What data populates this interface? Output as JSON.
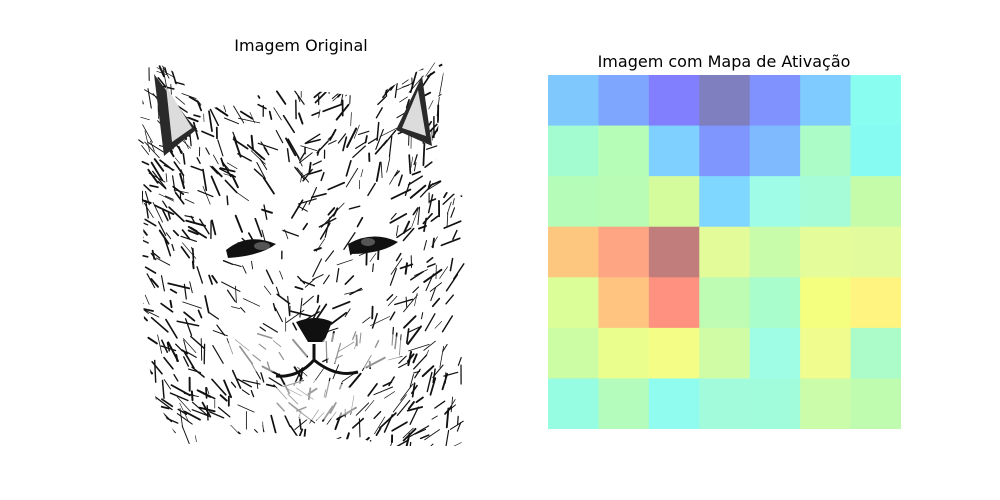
{
  "panels": {
    "left_title": "Imagem Original",
    "right_title": "Imagem com Mapa de Ativação"
  },
  "original_image": {
    "subject": "sketched-cat-face",
    "colors": {
      "ink": "#111111",
      "paper": "#ffffff"
    }
  },
  "chart_data": {
    "type": "heatmap",
    "title": "Imagem com Mapa de Ativação",
    "rows": 7,
    "cols": 7,
    "colors": [
      [
        "#7fc8fe",
        "#7fa6fe",
        "#817ffe",
        "#7f7fc0",
        "#7f92fe",
        "#7fcafe",
        "#88fdf0"
      ],
      [
        "#a3fcd0",
        "#b6fdb7",
        "#7fd0fe",
        "#7f96fe",
        "#7fbafe",
        "#abfcc7",
        "#86fbf1"
      ],
      [
        "#b5fcb8",
        "#b8fcb5",
        "#d4fc9d",
        "#7fd6fe",
        "#9ffce6",
        "#a5fcd6",
        "#c5fca9"
      ],
      [
        "#fec77f",
        "#fea683",
        "#c07d7c",
        "#e3fc99",
        "#c8fcab",
        "#e4fc99",
        "#e2fc9d"
      ],
      [
        "#dcfe99",
        "#fec480",
        "#fe917f",
        "#befcb3",
        "#a9fccc",
        "#f4fe7f",
        "#fef47f"
      ],
      [
        "#ccfca3",
        "#eafe8e",
        "#f4fe86",
        "#d0fca5",
        "#9ffce5",
        "#f0fc8d",
        "#abfcc8"
      ],
      [
        "#96fde3",
        "#b3fcbc",
        "#90fcef",
        "#a2fcdc",
        "#a1fcdc",
        "#cafca9",
        "#bffcb0"
      ]
    ]
  }
}
